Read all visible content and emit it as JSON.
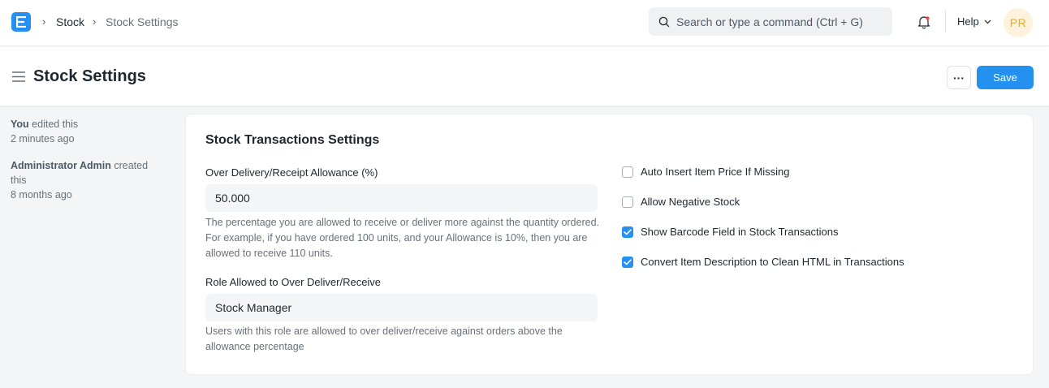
{
  "navbar": {
    "breadcrumbs": [
      "Stock",
      "Stock Settings"
    ],
    "search_placeholder": "Search or type a command (Ctrl + G)",
    "help_label": "Help",
    "avatar_initials": "PR",
    "accent_color": "#2490ef"
  },
  "page": {
    "title": "Stock Settings",
    "more_label": "···",
    "save_label": "Save"
  },
  "activity": [
    {
      "actor": "You",
      "action": " edited this",
      "time": "2 minutes ago"
    },
    {
      "actor": "Administrator Admin",
      "action": " created this",
      "time": "8 months ago"
    }
  ],
  "form": {
    "section_title": "Stock Transactions Settings",
    "over_delivery": {
      "label": "Over Delivery/Receipt Allowance (%)",
      "value": "50.000",
      "description": "The percentage you are allowed to receive or deliver more against the quantity ordered. For example, if you have ordered 100 units, and your Allowance is 10%, then you are allowed to receive 110 units."
    },
    "role_allowed": {
      "label": "Role Allowed to Over Deliver/Receive",
      "value": "Stock Manager",
      "description": "Users with this role are allowed to over deliver/receive against orders above the allowance percentage"
    },
    "checkboxes": [
      {
        "label": "Auto Insert Item Price If Missing",
        "checked": false
      },
      {
        "label": "Allow Negative Stock",
        "checked": false
      },
      {
        "label": "Show Barcode Field in Stock Transactions",
        "checked": true
      },
      {
        "label": "Convert Item Description to Clean HTML in Transactions",
        "checked": true
      }
    ]
  }
}
